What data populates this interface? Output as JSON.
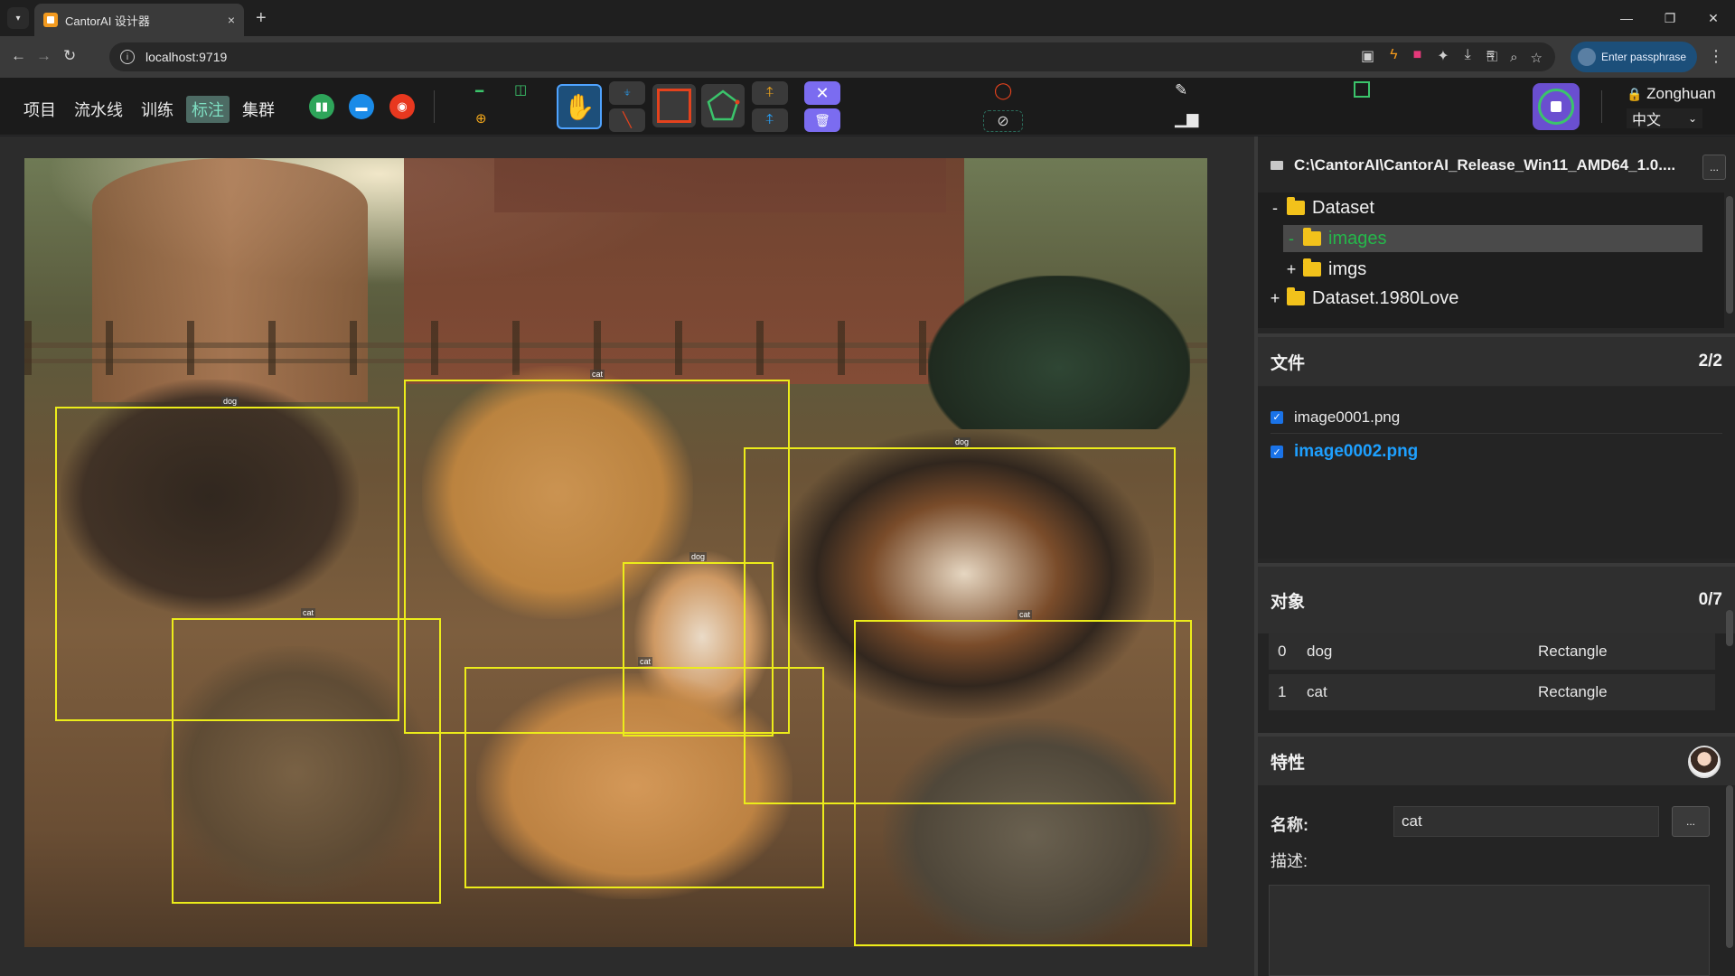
{
  "browser": {
    "tab_title": "CantorAI 设计器",
    "tab_close": "×",
    "new_tab": "+",
    "url": "localhost:9719",
    "passphrase_label": "Enter passphrase",
    "window_controls": [
      "—",
      "❐",
      "✕"
    ]
  },
  "app": {
    "nav": [
      "项目",
      "流水线",
      "训练",
      "标注",
      "集群"
    ],
    "active_nav": "标注",
    "user": "Zonghuan",
    "language": "中文"
  },
  "tools": {
    "tool_icons": [
      "line-icon",
      "mirror-icon",
      "crosshair-add-icon",
      "hand-icon",
      "point-down-icon",
      "slash-icon",
      "rectangle-icon",
      "polygon-icon",
      "point-up-icon",
      "point-mid-icon",
      "x-close-icon",
      "trash-icon",
      "red-ring-icon",
      "eye-slash-icon",
      "pencil-icon",
      "bar-chart-icon",
      "green-square-icon",
      "record-icon"
    ],
    "accent_colors": {
      "active_tool": "#1d4f7a",
      "rect_tool": "#e4421d",
      "polygon_tool": "#3bc46b",
      "delete": "#7b6cf0",
      "record": "#6a4fd0"
    }
  },
  "canvas": {
    "labels": {
      "dog": "dog",
      "cat": "cat"
    },
    "box_color": "#ecec1a",
    "boxes": [
      {
        "label": "dog"
      },
      {
        "label": "cat"
      },
      {
        "label": "dog"
      },
      {
        "label": "dog"
      },
      {
        "label": "cat"
      },
      {
        "label": "cat"
      },
      {
        "label": "cat"
      }
    ]
  },
  "panel": {
    "path": "C:\\CantorAI\\CantorAI_Release_Win11_AMD64_1.0....",
    "more": "...",
    "tree": [
      {
        "sign": "-",
        "name": "Dataset"
      },
      {
        "sign": "-",
        "name": "images",
        "selected": true
      },
      {
        "sign": "+",
        "name": "imgs"
      },
      {
        "sign": "+",
        "name": "Dataset.1980Love"
      }
    ],
    "files_title": "文件",
    "files_count": "2/2",
    "files": [
      {
        "name": "image0001.png",
        "checked": true
      },
      {
        "name": "image0002.png",
        "checked": true,
        "selected": true
      }
    ],
    "objects_title": "对象",
    "objects_count": "0/7",
    "objects": [
      {
        "index": "0",
        "name": "dog",
        "type": "Rectangle"
      },
      {
        "index": "1",
        "name": "cat",
        "type": "Rectangle"
      }
    ],
    "props_title": "特性",
    "name_label": "名称:",
    "name_value": "cat",
    "desc_label": "描述:",
    "desc_value": ""
  }
}
